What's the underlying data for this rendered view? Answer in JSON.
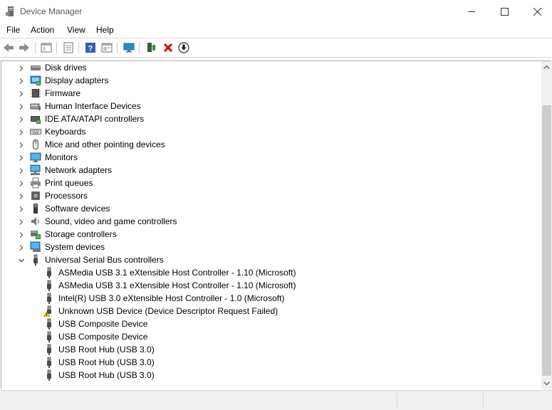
{
  "window": {
    "title": "Device Manager",
    "icon": "device-manager-icon"
  },
  "menu": {
    "items": [
      "File",
      "Action",
      "View",
      "Help"
    ]
  },
  "toolbar": {
    "buttons": [
      "back-icon",
      "forward-icon",
      "properties-pane-icon",
      "details-icon",
      "help-icon",
      "show-hidden-icon",
      "scan-changes-icon",
      "update-driver-icon",
      "uninstall-icon",
      "download-icon"
    ]
  },
  "colors": {
    "uninstall_red": "#d40000",
    "warning_yellow": "#f5c400",
    "monitor_blue": "#1f8fd6"
  },
  "tree": {
    "categories": [
      {
        "label": "Disk drives",
        "icon": "disk-drive-icon",
        "expanded": false
      },
      {
        "label": "Display adapters",
        "icon": "display-adapter-icon",
        "expanded": false
      },
      {
        "label": "Firmware",
        "icon": "firmware-icon",
        "expanded": false
      },
      {
        "label": "Human Interface Devices",
        "icon": "hid-icon",
        "expanded": false
      },
      {
        "label": "IDE ATA/ATAPI controllers",
        "icon": "ide-controller-icon",
        "expanded": false
      },
      {
        "label": "Keyboards",
        "icon": "keyboard-icon",
        "expanded": false
      },
      {
        "label": "Mice and other pointing devices",
        "icon": "mouse-icon",
        "expanded": false
      },
      {
        "label": "Monitors",
        "icon": "monitor-icon",
        "expanded": false
      },
      {
        "label": "Network adapters",
        "icon": "network-adapter-icon",
        "expanded": false
      },
      {
        "label": "Print queues",
        "icon": "printer-icon",
        "expanded": false
      },
      {
        "label": "Processors",
        "icon": "processor-icon",
        "expanded": false
      },
      {
        "label": "Software devices",
        "icon": "software-device-icon",
        "expanded": false
      },
      {
        "label": "Sound, video and game controllers",
        "icon": "speaker-icon",
        "expanded": false
      },
      {
        "label": "Storage controllers",
        "icon": "storage-controller-icon",
        "expanded": false
      },
      {
        "label": "System devices",
        "icon": "system-device-icon",
        "expanded": false
      },
      {
        "label": "Universal Serial Bus controllers",
        "icon": "usb-icon",
        "expanded": true
      }
    ],
    "usb_children": [
      {
        "label": "ASMedia USB 3.1 eXtensible Host Controller - 1.10 (Microsoft)",
        "icon": "usb-icon"
      },
      {
        "label": "ASMedia USB 3.1 eXtensible Host Controller - 1.10 (Microsoft)",
        "icon": "usb-icon"
      },
      {
        "label": "Intel(R) USB 3.0 eXtensible Host Controller - 1.0 (Microsoft)",
        "icon": "usb-icon"
      },
      {
        "label": "Unknown USB Device (Device Descriptor Request Failed)",
        "icon": "usb-warning-icon"
      },
      {
        "label": "USB Composite Device",
        "icon": "usb-icon"
      },
      {
        "label": "USB Composite Device",
        "icon": "usb-icon"
      },
      {
        "label": "USB Root Hub (USB 3.0)",
        "icon": "usb-icon"
      },
      {
        "label": "USB Root Hub (USB 3.0)",
        "icon": "usb-icon"
      },
      {
        "label": "USB Root Hub (USB 3.0)",
        "icon": "usb-icon"
      }
    ]
  }
}
